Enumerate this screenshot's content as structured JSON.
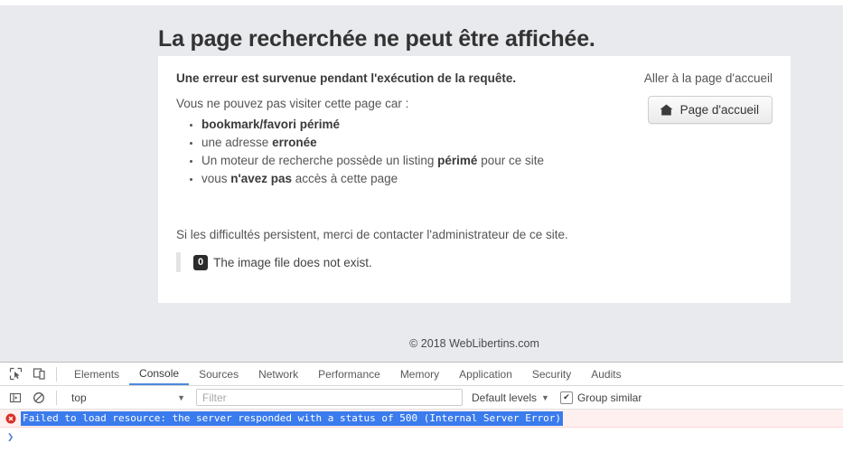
{
  "page": {
    "title": "La page recherchée ne peut être affichée.",
    "error_heading": "Une erreur est survenue pendant l'exécution de la requête.",
    "error_subheading": "Vous ne pouvez pas visiter cette page car :",
    "reasons": [
      {
        "pre": "",
        "bold": "bookmark/favori périmé",
        "post": ""
      },
      {
        "pre": "une adresse ",
        "bold": "erronée",
        "post": ""
      },
      {
        "pre": "Un moteur de recherche possède un listing ",
        "bold": "périmé",
        "post": " pour ce site"
      },
      {
        "pre": "vous ",
        "bold": "n'avez pas",
        "post": " accès à cette page"
      }
    ],
    "contact_line": "Si les difficultés persistent, merci de contacter l'administrateur de ce site.",
    "quote_badge": "0",
    "quote_text": "The image file does not exist.",
    "aside_label": "Aller à la page d'accueil",
    "home_button_label": "Page d'accueil",
    "home_button_icon": "home-icon",
    "footer": "© 2018 WebLibertins.com",
    "colors": {
      "background": "#e9eaee",
      "card": "#ffffff",
      "title_text": "#333333",
      "body_text": "#555555"
    }
  },
  "devtools": {
    "toolbar_icons": [
      {
        "name": "inspect-element-icon"
      },
      {
        "name": "device-toolbar-icon"
      }
    ],
    "tabs": [
      {
        "label": "Elements",
        "active": false
      },
      {
        "label": "Console",
        "active": true
      },
      {
        "label": "Sources",
        "active": false
      },
      {
        "label": "Network",
        "active": false
      },
      {
        "label": "Performance",
        "active": false
      },
      {
        "label": "Memory",
        "active": false
      },
      {
        "label": "Application",
        "active": false
      },
      {
        "label": "Security",
        "active": false
      },
      {
        "label": "Audits",
        "active": false
      }
    ],
    "console_toolbar": {
      "sidebar_toggle_icon": "console-sidebar-icon",
      "clear_icon": "clear-console-icon",
      "context_value": "top",
      "context_caret": "▼",
      "filter_placeholder": "Filter",
      "filter_value": "",
      "levels_label": "Default levels",
      "levels_caret": "▼",
      "group_similar_label": "Group similar",
      "group_similar_checked": true,
      "checkmark": "✔"
    },
    "messages": [
      {
        "level": "error",
        "icon": "error-circle-icon",
        "text": "Failed to load resource: the server responded with a status of 500 (Internal Server Error)",
        "selected": true
      }
    ],
    "prompt_caret": "❯",
    "colors": {
      "active_tab_underline": "#4a89dc",
      "error_row_background": "#fff0f0",
      "selection_background": "#3a7bed",
      "error_icon": "#d93025"
    }
  }
}
